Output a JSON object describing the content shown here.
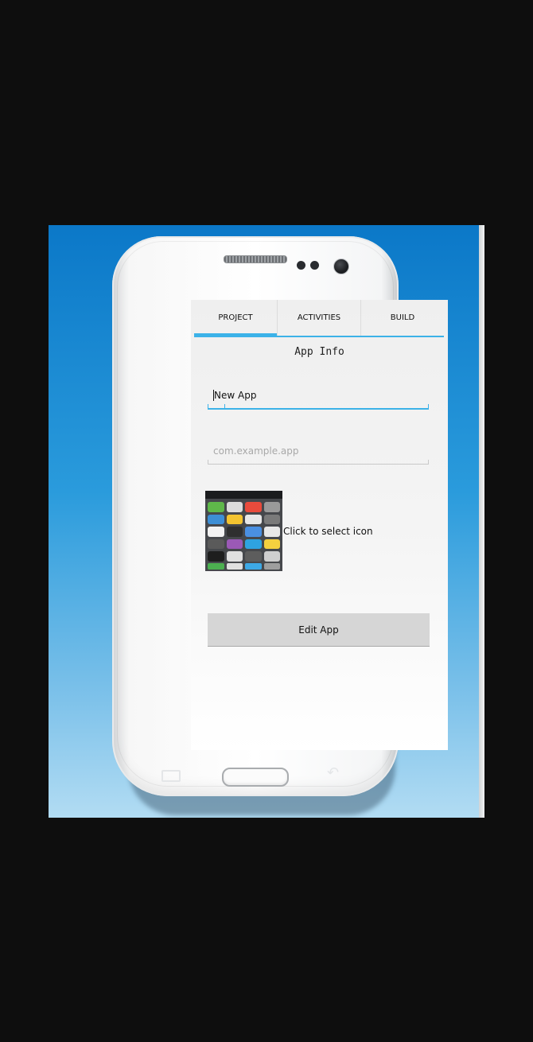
{
  "tabs": [
    {
      "label": "PROJECT",
      "active": true
    },
    {
      "label": "ACTIVITIES",
      "active": false
    },
    {
      "label": "BUILD",
      "active": false
    }
  ],
  "section_title": "App Info",
  "app_name": {
    "value": "New App"
  },
  "package_name": {
    "placeholder": "com.example.app"
  },
  "icon_picker": {
    "label": "Click to select icon",
    "thumbnail": "phone-homescreen-screenshot"
  },
  "edit_button": {
    "label": "Edit App"
  },
  "nav_keys": {
    "menu": "menu-icon",
    "home": "home-button",
    "back": "back-icon"
  },
  "colors": {
    "accent": "#3cb2e8",
    "button_bg": "#d6d6d6",
    "emulator_bg_top": "#0b78c8"
  }
}
